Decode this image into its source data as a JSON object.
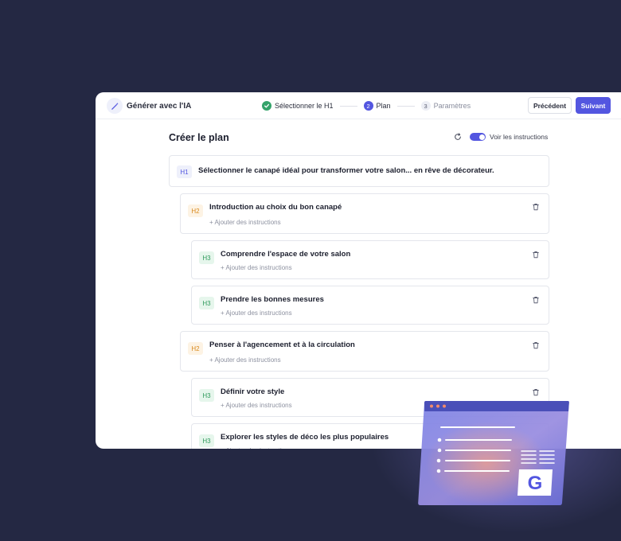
{
  "header": {
    "title": "Générer avec l'IA",
    "steps": [
      {
        "number": "",
        "label": "Sélectionner le H1",
        "state": "done"
      },
      {
        "number": "2",
        "label": "Plan",
        "state": "active"
      },
      {
        "number": "3",
        "label": "Paramètres",
        "state": "todo"
      }
    ],
    "prev_label": "Précédent",
    "next_label": "Suivant"
  },
  "main": {
    "title": "Créer le plan",
    "toggle_label": "Voir les instructions",
    "toggle_on": true,
    "add_label": "+ Ajouter des instructions",
    "h1": {
      "tag": "H1",
      "title": "Sélectionner le canapé idéal pour transformer votre salon... en rêve de décorateur."
    },
    "sections": [
      {
        "tag": "H2",
        "title": "Introduction au choix du bon canapé"
      },
      {
        "tag": "H3",
        "title": "Comprendre l'espace de votre salon"
      },
      {
        "tag": "H3",
        "title": "Prendre les bonnes mesures"
      },
      {
        "tag": "H2",
        "title": "Penser à l'agencement et à la circulation"
      },
      {
        "tag": "H3",
        "title": "Définir votre style"
      },
      {
        "tag": "H3",
        "title": "Explorer les styles de déco les plus populaires"
      }
    ]
  },
  "illustration": {
    "logo_letter": "G"
  },
  "colors": {
    "accent": "#5356e0",
    "h2": "#d98a1e",
    "h3": "#2f9a5c",
    "background": "#242843"
  }
}
